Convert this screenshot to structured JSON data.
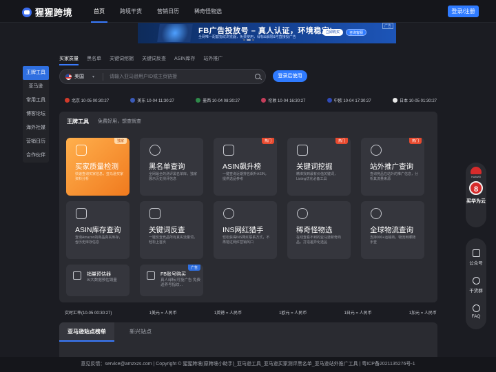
{
  "header": {
    "logo_text": "猩猩跨境",
    "nav": [
      "首页",
      "跨境干货",
      "营销日历",
      "稀奇怪物选"
    ],
    "login": "登录/注册"
  },
  "banner": {
    "title": "FB广告投放号 – 真人认证，环境稳定!",
    "sub": "全网唯一配套指纹浏览器，免费使用，绿标&解限&可直接投广告",
    "btn1": "立即购买",
    "btn2": "咨询客服",
    "ad": "广告"
  },
  "sidebar": [
    "王牌工具",
    "亚马逊",
    "常用工具",
    "博客论坛",
    "海外社媒",
    "营销日历",
    "合作伙伴"
  ],
  "tabs": [
    "买家质量",
    "黑名单",
    "关键词挖掘",
    "关键词反查",
    "ASIN库存",
    "站外推广"
  ],
  "search": {
    "country": "美国",
    "placeholder": "请输入亚马逊用户ID或主页链接",
    "button": "登录后使用"
  },
  "times": [
    {
      "label": "北京 10-05 00:30:27",
      "color": "#d23a2a"
    },
    {
      "label": "美东 10-04 11:30:27",
      "color": "#3a5ab8"
    },
    {
      "label": "墨西 10-04 08:30:27",
      "color": "#2f8a4a"
    },
    {
      "label": "伦敦 10-04 16:30:27",
      "color": "#c43d5a"
    },
    {
      "label": "中欧 10-04 17:30:27",
      "color": "#2f4ab8"
    },
    {
      "label": "日本 10-05 01:30:27",
      "color": "#e8e8e8"
    }
  ],
  "panel": {
    "title": "王牌工具",
    "subtitle": "免费好用，想查就查"
  },
  "cards": [
    {
      "title": "买家质量检测",
      "desc": "快速查询买家信息，亚马逊买家资料分析",
      "badge": "独家",
      "icon": "shield-icon"
    },
    {
      "title": "黑名单查询",
      "desc": "全网最全的测评黑名单库，独家展示历史测评信息",
      "badge": "",
      "icon": "cat-icon"
    },
    {
      "title": "ASIN飙升榜",
      "desc": "一键查询近期排名飙升ASIN，提供选品参考",
      "badge": "热门",
      "icon": "rocket-icon"
    },
    {
      "title": "关键词挖掘",
      "desc": "精准找到最有价值关键词，Listing优化必备工具",
      "badge": "热门",
      "icon": "tag-icon"
    },
    {
      "title": "站外推广查询",
      "desc": "查询竞品在站外的推广信息，分析其流量来源",
      "badge": "热门",
      "icon": "user-search-icon"
    },
    {
      "title": "ASIN库存查询",
      "desc": "查询Amazon的商品真实库存，含历史库存信息",
      "badge": "",
      "icon": "box-icon"
    },
    {
      "title": "关键词反查",
      "desc": "一键反查竞品所有真实流量词，轻松上首页",
      "badge": "",
      "icon": "camera-icon"
    },
    {
      "title": "INS网红猎手",
      "desc": "轻松获得INS网红联系方式，不再错过网红营销风口",
      "badge": "",
      "icon": "person-icon"
    },
    {
      "title": "稀奇怪物选",
      "desc": "在线查看不到的亚马逊新奇商品，打造差异化选品",
      "badge": "",
      "icon": "link-icon"
    },
    {
      "title": "全球物流查询",
      "desc": "支持900+运输商，物流到哪随手查",
      "badge": "",
      "icon": "globe-icon"
    }
  ],
  "small_cards": [
    {
      "title": "销量预估器",
      "desc": "AI大数据预估销量",
      "badge": "",
      "icon": "chart-icon"
    },
    {
      "title": "FB账号购买",
      "desc": "真人绿标|可投广告 免费送养号指纹...",
      "badge": "广告",
      "icon": "fb-icon"
    }
  ],
  "rates": {
    "label": "实时汇率(10-05 00:30:27)",
    "items": [
      "1美元 = 人民币",
      "1英镑 = 人民币",
      "1欧元 = 人民币",
      "1日元 = 人民币",
      "1加元 = 人民币"
    ]
  },
  "sites": {
    "active": "亚马逊站点榜单",
    "other": "新兴站点"
  },
  "footer": "意见反馈：service@amzxzs.com  |  Copyright © 猩猩跨境(原跨境小助手)_亚马逊工具_亚马逊买家测评黑名单_亚马逊站外推广工具  |  粤ICP备2021135276号-1",
  "huawei": {
    "name": "HUAWEI",
    "num": "8",
    "text": "买华为云"
  },
  "float": [
    "公众号",
    "干货群",
    "FAQ"
  ]
}
